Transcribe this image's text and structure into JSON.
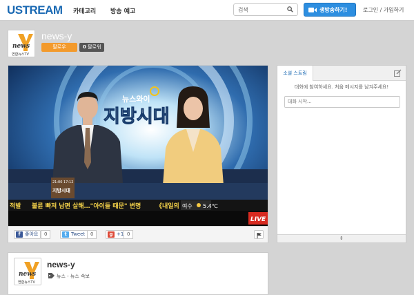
{
  "header": {
    "logo": "USTREAM",
    "nav": [
      "카테고리",
      "방송 예고"
    ],
    "search_placeholder": "검색",
    "broadcast_label": "생방송하기!",
    "auth_label": "로그인 / 가입하기"
  },
  "channel": {
    "title": "news-y",
    "logo_text": "news",
    "logo_sub": "연합뉴스TV",
    "follow_label": "팔로우",
    "followers_count": "0",
    "followers_label": "팔로워"
  },
  "video": {
    "show_brand": "뉴스와이",
    "show_title": "지방시대",
    "ticker_left": "적발",
    "ticker_main": "불륜 빠져 남편 살해…\"아이들 때문\" 변명",
    "ticker_right": "《내일의",
    "weather_city": "여수",
    "weather_temp": "5.4℃",
    "live_label": "LIVE",
    "lower_time": "21:00 17:12",
    "lower_badge": "지방시대"
  },
  "share": {
    "facebook_label": "좋아요",
    "facebook_count": "0",
    "tweet_label": "Tweet",
    "tweet_count": "0",
    "gplus_label": "+1",
    "gplus_count": "0"
  },
  "social": {
    "tab_label": "소셜 스트림",
    "hint": "대화에 참여하세요. 처음 메시지를 남겨주세요!",
    "compose_placeholder": "대화 시작..."
  },
  "info": {
    "title": "news-y",
    "categories": "뉴스 - 뉴스 속보"
  },
  "colors": {
    "brand_blue": "#1a69b3",
    "follow_orange": "#f39a2b",
    "live_red": "#d82a20"
  }
}
